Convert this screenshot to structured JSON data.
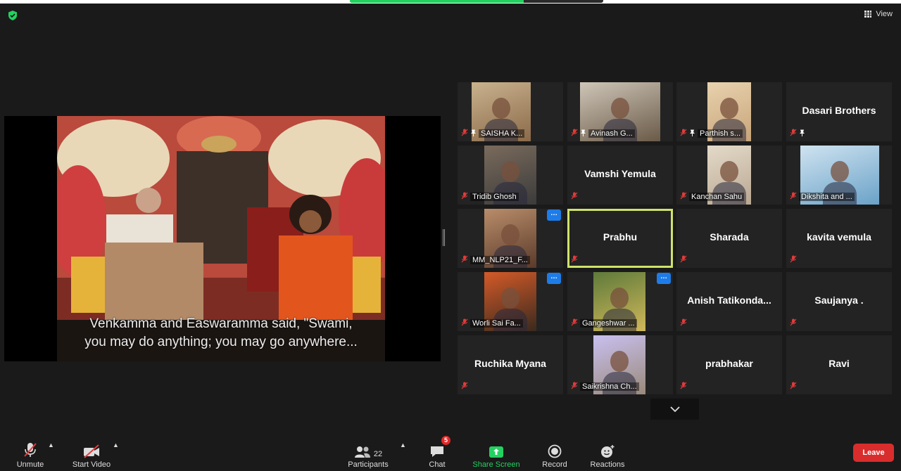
{
  "header": {
    "view_label": "View"
  },
  "share": {
    "subtitle_line1": "Venkamma and Easwaramma said, \"Swami,",
    "subtitle_line2": "you may do anything; you may go anywhere..."
  },
  "gallery": {
    "tiles": [
      {
        "name": "SAISHA K...",
        "type": "video",
        "pinned": true
      },
      {
        "name": "Avinash G...",
        "type": "video",
        "pinned": true
      },
      {
        "name": "Parthish s...",
        "type": "video",
        "pinned": true
      },
      {
        "name": "Dasari Brothers",
        "type": "name",
        "pinned": true
      },
      {
        "name": "Tridib Ghosh",
        "type": "video"
      },
      {
        "name": "Vamshi Yemula",
        "type": "name"
      },
      {
        "name": "Kanchan Sahu",
        "type": "video"
      },
      {
        "name": "Dikshita and ...",
        "type": "video"
      },
      {
        "name": "MM_NLP21_F...",
        "type": "video",
        "more": true
      },
      {
        "name": "Prabhu",
        "type": "name",
        "active": true
      },
      {
        "name": "Sharada",
        "type": "name"
      },
      {
        "name": "kavita vemula",
        "type": "name"
      },
      {
        "name": "Worli Sai Fa...",
        "type": "video",
        "more": true
      },
      {
        "name": "Gangeshwar ...",
        "type": "video",
        "more": true
      },
      {
        "name": "Anish  Tatikonda...",
        "type": "name"
      },
      {
        "name": "Saujanya .",
        "type": "name"
      },
      {
        "name": "Ruchika Myana",
        "type": "name"
      },
      {
        "name": "Saikrishna Ch...",
        "type": "video"
      },
      {
        "name": "prabhakar",
        "type": "name"
      },
      {
        "name": "Ravi",
        "type": "name"
      }
    ]
  },
  "toolbar": {
    "unmute": "Unmute",
    "start_video": "Start Video",
    "participants": "Participants",
    "participants_count": "22",
    "chat": "Chat",
    "chat_badge": "5",
    "share_screen": "Share Screen",
    "record": "Record",
    "reactions": "Reactions",
    "leave": "Leave"
  },
  "colors": {
    "accent_green": "#23d160",
    "active_speaker": "#cfe26a",
    "leave_red": "#d92d2d",
    "more_blue": "#1e7ce8",
    "mic_off_red": "#e23b3b"
  },
  "icons": [
    "shield-icon",
    "view-grid-icon",
    "mic-off-icon",
    "video-off-icon",
    "participants-icon",
    "chat-icon",
    "share-screen-icon",
    "record-icon",
    "reactions-icon",
    "chevron-down-icon",
    "pin-icon",
    "more-icon"
  ]
}
